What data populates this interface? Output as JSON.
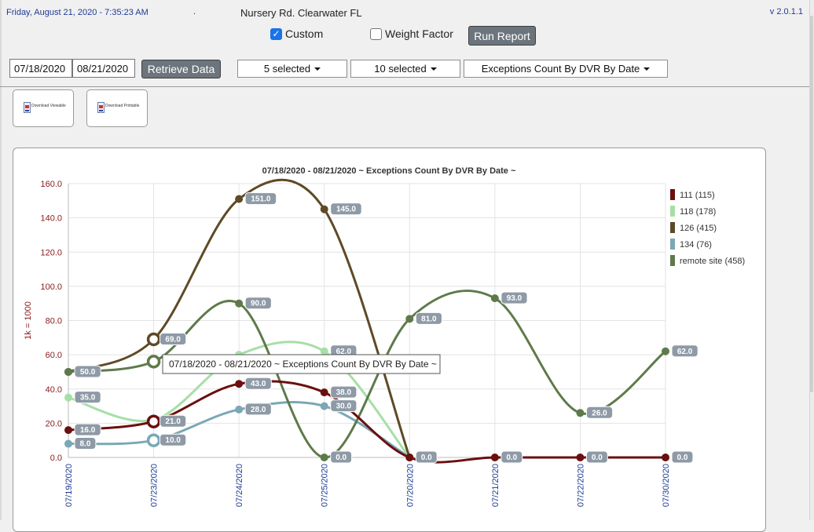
{
  "header": {
    "datetime": "Friday, August 21, 2020 - 7:35:23 AM",
    "separator": ".",
    "location": "Nursery Rd. Clearwater FL",
    "version": "v 2.0.1.1"
  },
  "options": {
    "custom_label": "Custom",
    "custom_checked": true,
    "weight_label": "Weight Factor",
    "weight_checked": false,
    "run_label": "Run Report"
  },
  "filters": {
    "start_date": "07/18/2020",
    "end_date": "08/21/2020",
    "retrieve_label": "Retrieve Data",
    "dropdown1": "5 selected",
    "dropdown2": "10 selected",
    "dropdown3": "Exceptions Count By DVR By Date"
  },
  "export_buttons": [
    {
      "label": "Download Viewable"
    },
    {
      "label": "Download Printable"
    }
  ],
  "tooltip": "07/18/2020 - 08/21/2020 ~ Exceptions Count By DVR By Date ~",
  "chart_data": {
    "type": "line",
    "title": "07/18/2020 - 08/21/2020 ~ Exceptions Count By DVR By Date ~",
    "ylabel": "1k = 1000",
    "xlabel": "",
    "ylim": [
      0,
      160
    ],
    "yticks": [
      "0.0",
      "20.0",
      "40.0",
      "60.0",
      "80.0",
      "100.0",
      "120.0",
      "140.0",
      "160.0"
    ],
    "categories": [
      "07/19/2020",
      "07/23/2020",
      "07/24/2020",
      "07/25/2020",
      "07/20/2020",
      "07/21/2020",
      "07/22/2020",
      "07/30/2020"
    ],
    "grid": true,
    "legend_position": "right",
    "series": [
      {
        "name": "111 (115)",
        "color": "#6b0f0f",
        "values": [
          16,
          21,
          43,
          38,
          0,
          0,
          0,
          0
        ]
      },
      {
        "name": "118 (178)",
        "color": "#a6dfa6",
        "values": [
          35,
          22,
          60,
          62,
          0,
          null,
          null,
          null
        ]
      },
      {
        "name": "126 (415)",
        "color": "#5e4a26",
        "values": [
          50,
          69,
          151,
          145,
          0,
          null,
          null,
          null
        ]
      },
      {
        "name": "134 (76)",
        "color": "#7aa8b4",
        "values": [
          8,
          10,
          28,
          30,
          0,
          null,
          null,
          null
        ]
      },
      {
        "name": "remote site (458)",
        "color": "#5e7a4a",
        "values": [
          50,
          56,
          90,
          0,
          81,
          93,
          26,
          62
        ]
      }
    ],
    "data_labels": [
      {
        "series": 0,
        "index": 0,
        "text": "16.0"
      },
      {
        "series": 0,
        "index": 1,
        "text": "21.0"
      },
      {
        "series": 0,
        "index": 2,
        "text": "43.0"
      },
      {
        "series": 0,
        "index": 3,
        "text": "38.0"
      },
      {
        "series": 0,
        "index": 4,
        "text": "0.0"
      },
      {
        "series": 0,
        "index": 5,
        "text": "0.0"
      },
      {
        "series": 0,
        "index": 6,
        "text": "0.0"
      },
      {
        "series": 0,
        "index": 7,
        "text": "0.0"
      },
      {
        "series": 1,
        "index": 0,
        "text": "35.0"
      },
      {
        "series": 1,
        "index": 3,
        "text": "62.0"
      },
      {
        "series": 2,
        "index": 0,
        "text": "50.0"
      },
      {
        "series": 2,
        "index": 1,
        "text": "69.0"
      },
      {
        "series": 2,
        "index": 2,
        "text": "151.0"
      },
      {
        "series": 2,
        "index": 3,
        "text": "145.0"
      },
      {
        "series": 3,
        "index": 0,
        "text": "8.0"
      },
      {
        "series": 3,
        "index": 1,
        "text": "10.0"
      },
      {
        "series": 3,
        "index": 2,
        "text": "28.0"
      },
      {
        "series": 3,
        "index": 3,
        "text": "30.0"
      },
      {
        "series": 4,
        "index": 2,
        "text": "90.0"
      },
      {
        "series": 4,
        "index": 3,
        "text": "0.0"
      },
      {
        "series": 4,
        "index": 4,
        "text": "81.0"
      },
      {
        "series": 4,
        "index": 5,
        "text": "93.0"
      },
      {
        "series": 4,
        "index": 6,
        "text": "26.0"
      },
      {
        "series": 4,
        "index": 7,
        "text": "62.0"
      }
    ]
  }
}
